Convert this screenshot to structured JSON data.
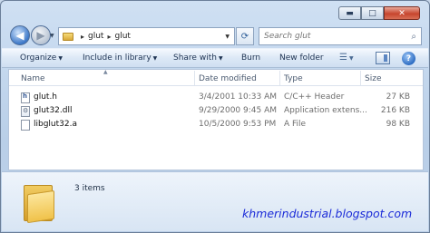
{
  "window": {
    "caption_buttons": {
      "minimize": "▬",
      "maximize": "□",
      "close": "✕"
    }
  },
  "navigation": {
    "back_glyph": "◀",
    "forward_glyph": "▶",
    "breadcrumb": [
      "glut",
      "glut"
    ],
    "separator": "▸",
    "refresh_glyph": "⟳",
    "search_placeholder": "Search glut",
    "search_glyph": "⌕"
  },
  "toolbar": {
    "organize": "Organize",
    "include_in_library": "Include in library",
    "share_with": "Share with",
    "burn": "Burn",
    "new_folder": "New folder",
    "views_glyph": "☰",
    "help_glyph": "?"
  },
  "columns": {
    "name": "Name",
    "date_modified": "Date modified",
    "type": "Type",
    "size": "Size"
  },
  "files": [
    {
      "name": "glut.h",
      "date": "3/4/2001 10:33 AM",
      "type": "C/C++ Header",
      "size": "27 KB",
      "icon": "header-file-icon"
    },
    {
      "name": "glut32.dll",
      "date": "9/29/2000 9:45 AM",
      "type": "Application extens...",
      "size": "216 KB",
      "icon": "dll-file-icon"
    },
    {
      "name": "libglut32.a",
      "date": "10/5/2000 9:53 PM",
      "type": "A File",
      "size": "98 KB",
      "icon": "generic-file-icon"
    }
  ],
  "details": {
    "item_count": "3 items",
    "watermark": "khmerindustrial.blogspot.com"
  },
  "colors": {
    "accent": "#3d78c8",
    "close": "#c7462e",
    "watermark": "#1b2bd8"
  }
}
